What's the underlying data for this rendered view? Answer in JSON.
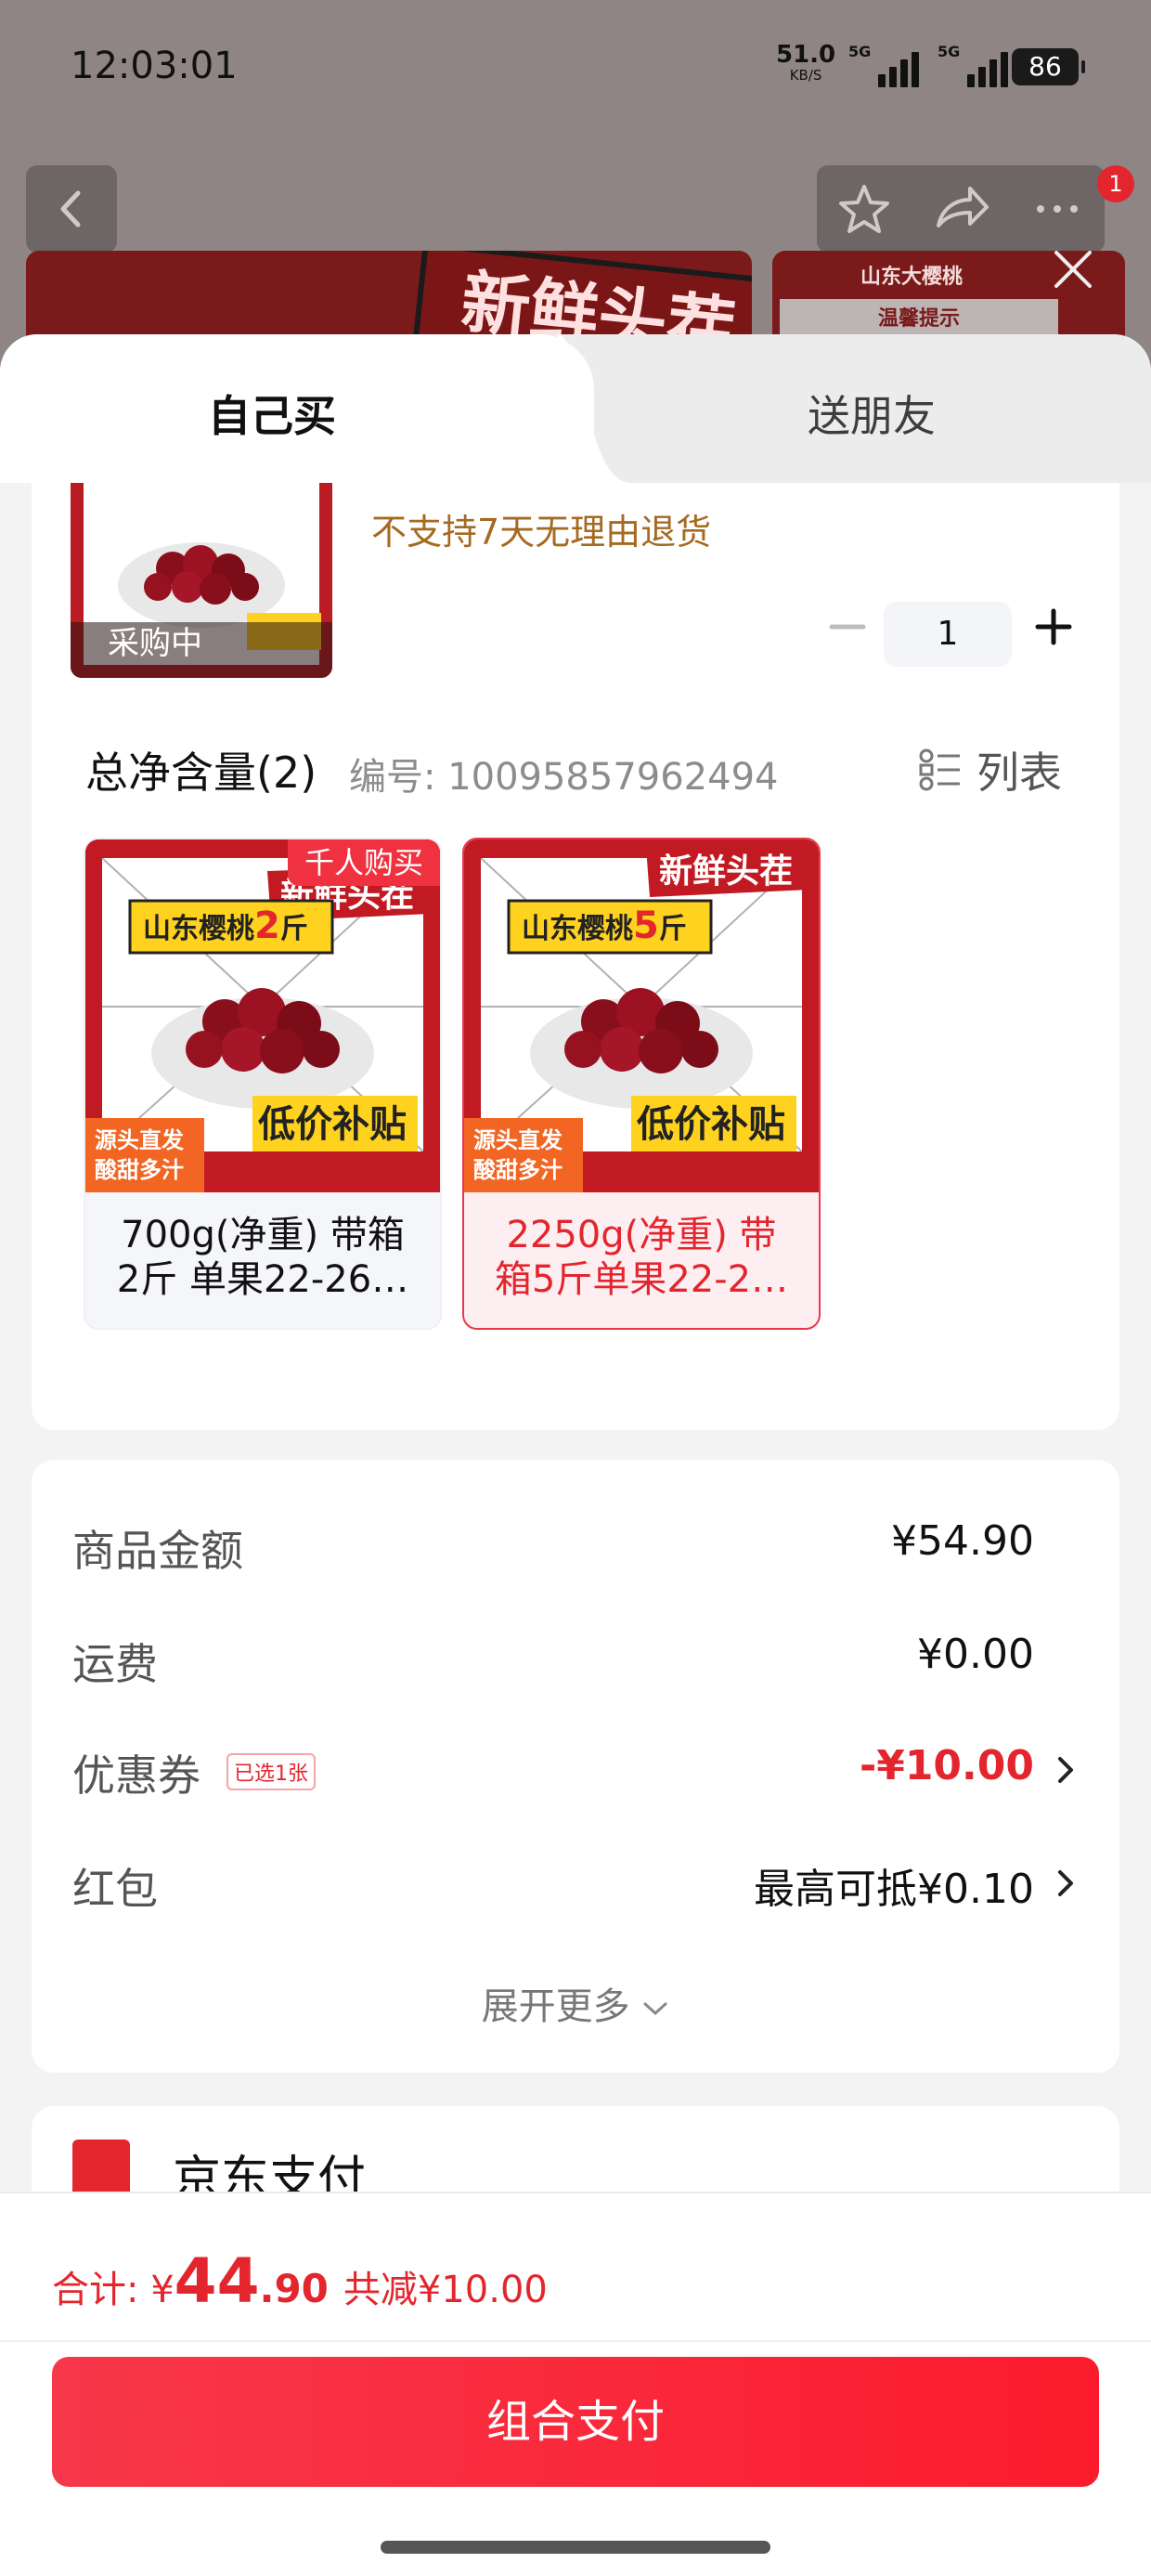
{
  "status_bar": {
    "time": "12:03:01",
    "net_speed": "51.0",
    "net_unit": "KB/S",
    "signal1_label": "5G",
    "signal2_label": "5G",
    "battery": "86"
  },
  "top_banner": {
    "left_tag": "新鲜头茬",
    "right_title": "山东大樱桃",
    "right_sub": "温馨提示",
    "cart_count": "1"
  },
  "tabs": {
    "self": "自己买",
    "friend": "送朋友"
  },
  "product": {
    "thumb_label": "采购中",
    "return_note": "不支持7天无理由退货",
    "quantity": "1"
  },
  "spec": {
    "title": "总净含量(2)",
    "code": "编号: 10095857962494",
    "list_label": "列表"
  },
  "variants": [
    {
      "badge": "千人购买",
      "tag": "新鲜头茬",
      "heading_prefix": "山东樱桃",
      "heading_num": "2",
      "heading_unit": "斤",
      "promo": "低价补贴",
      "side1": "源头直发",
      "side2": "酸甜多汁",
      "name": "700g(净重) 带箱\n2斤 单果22-26…"
    },
    {
      "tag": "新鲜头茬",
      "heading_prefix": "山东樱桃",
      "heading_num": "5",
      "heading_unit": "斤",
      "promo": "低价补贴",
      "side1": "源头直发",
      "side2": "酸甜多汁",
      "name": "2250g(净重) 带\n箱5斤单果22-2…"
    }
  ],
  "fees": {
    "goods_label": "商品金额",
    "goods_value": "¥54.90",
    "shipping_label": "运费",
    "shipping_value": "¥0.00",
    "coupon_label": "优惠券",
    "coupon_tag": "已选1张",
    "coupon_value": "-¥10.00",
    "redpacket_label": "红包",
    "redpacket_value": "最高可抵¥0.10",
    "expand_label": "展开更多"
  },
  "payment": {
    "method_label": "京东支付"
  },
  "footer": {
    "total_label": "合计: ¥",
    "total_int": "44",
    "total_dec": ".90",
    "saved": "共减¥10.00",
    "pay_button": "组合支付"
  },
  "colors": {
    "accent_red": "#e3262e",
    "warning_brown": "#a46a21"
  }
}
